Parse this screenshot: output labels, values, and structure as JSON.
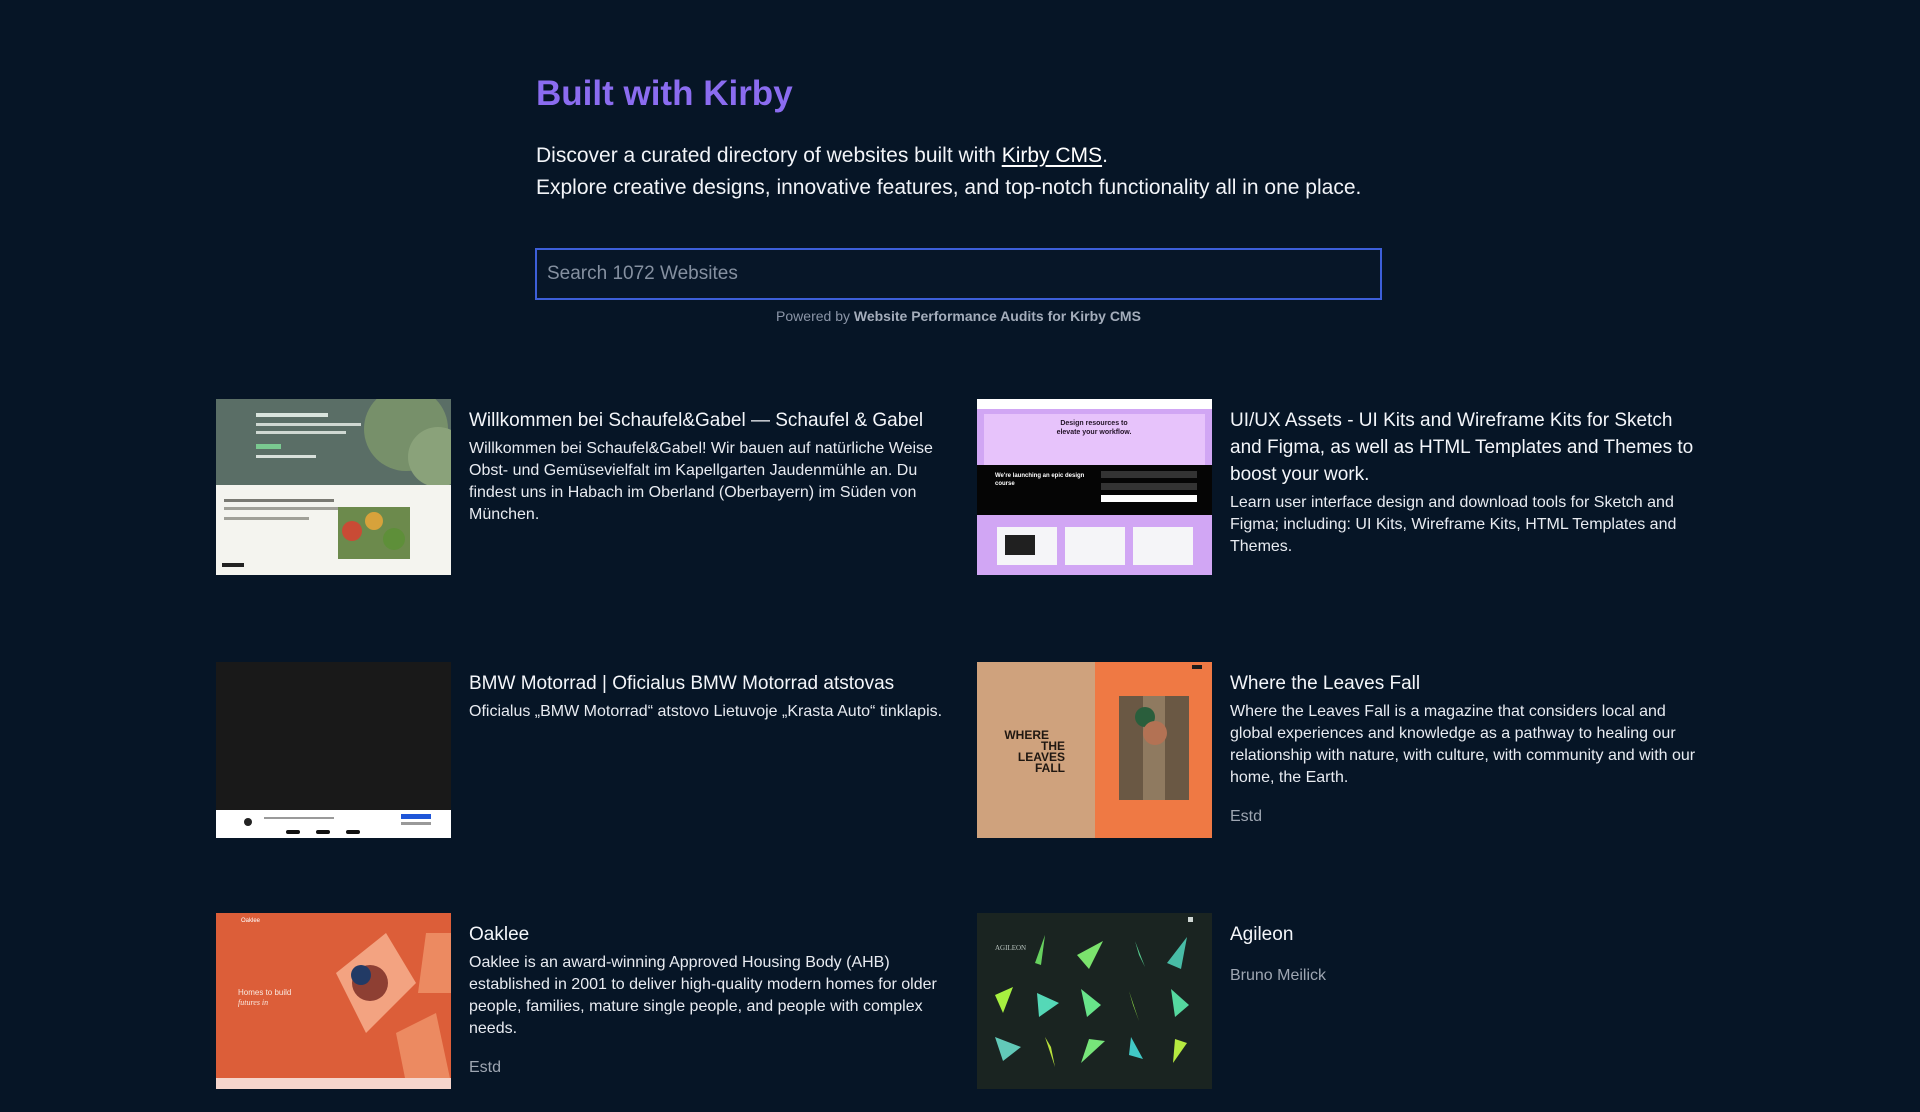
{
  "header": {
    "title": "Built with Kirby",
    "intro_line1_prefix": "Discover a curated directory of websites built with ",
    "intro_link": "Kirby CMS",
    "intro_line1_suffix": ".",
    "intro_line2": "Explore creative designs, innovative features, and top-notch functionality all in one place."
  },
  "search": {
    "placeholder": "Search 1072 Websites",
    "value": ""
  },
  "powered": {
    "prefix": "Powered by",
    "link": "Website Performance Audits for Kirby CMS"
  },
  "sites": [
    {
      "title": "Willkommen bei Schaufel&Gabel — Schaufel & Gabel",
      "description": "Willkommen bei Schaufel&Gabel! Wir bauen auf natürliche Weise Obst- und Gemüsevielfalt im Kapellgarten Jaudenmühle an. Du findest uns in Habach im Oberland (Oberbayern) im Süden von München.",
      "meta": ""
    },
    {
      "title": "UI/UX Assets - UI Kits and Wireframe Kits for Sketch and Figma, as well as HTML Templates and Themes to boost your work.",
      "description": "Learn user interface design and download tools for Sketch and Figma; including: UI Kits, Wireframe Kits, HTML Templates and Themes.",
      "meta": ""
    },
    {
      "title": "BMW Motorrad | Oficialus BMW Motorrad atstovas",
      "description": "Oficialus „BMW Motorrad“ atstovo Lietuvoje „Krasta Auto“ tinklapis.",
      "meta": ""
    },
    {
      "title": "Where the Leaves Fall",
      "description": "Where the Leaves Fall is a magazine that considers local and global experiences and knowledge as a pathway to healing our relationship with nature, with culture, with community and with our home, the Earth.",
      "meta": "Estd"
    },
    {
      "title": "Oaklee",
      "description": "Oaklee is an award-winning Approved Housing Body (AHB) established in 2001 to deliver high-quality modern homes for older people, families, mature single people, and people with complex needs.",
      "meta": "Estd"
    },
    {
      "title": "Agileon",
      "description": "",
      "meta": "Bruno Meilick"
    }
  ],
  "thumbnails": {
    "uiux": {
      "headline_line1": "Design resources to",
      "headline_line2": "elevate your workflow.",
      "course_line1": "We're launching an epic design",
      "course_line2": "course"
    },
    "leaves": {
      "word1": "WHERE",
      "word2": "THE",
      "word3": "LEAVES",
      "word4": "FALL"
    },
    "oaklee": {
      "logo": "Oaklee",
      "tagline_line1": "Homes to build",
      "tagline_line2": "futures in"
    },
    "agileon": {
      "logo": "AGILEON"
    }
  },
  "colors": {
    "background": "#061526",
    "title": "#8b6cf0",
    "search_border": "#3d5fd9"
  }
}
